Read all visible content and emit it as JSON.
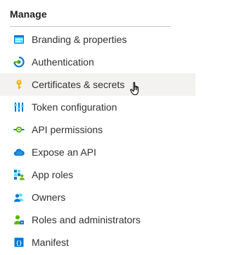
{
  "section": {
    "title": "Manage"
  },
  "nav": {
    "items": [
      {
        "label": "Branding & properties",
        "icon": "branding-icon"
      },
      {
        "label": "Authentication",
        "icon": "authentication-icon"
      },
      {
        "label": "Certificates & secrets",
        "icon": "key-icon"
      },
      {
        "label": "Token configuration",
        "icon": "token-configuration-icon"
      },
      {
        "label": "API permissions",
        "icon": "api-permissions-icon"
      },
      {
        "label": "Expose an API",
        "icon": "cloud-icon"
      },
      {
        "label": "App roles",
        "icon": "app-roles-icon"
      },
      {
        "label": "Owners",
        "icon": "owners-icon"
      },
      {
        "label": "Roles and administrators",
        "icon": "roles-administrators-icon"
      },
      {
        "label": "Manifest",
        "icon": "manifest-icon"
      }
    ],
    "hovered_index": 2
  },
  "colors": {
    "hover_bg": "#f3f2f1",
    "accent_blue": "#0078d4",
    "key_yellow": "#f2b200",
    "green": "#5db300"
  }
}
